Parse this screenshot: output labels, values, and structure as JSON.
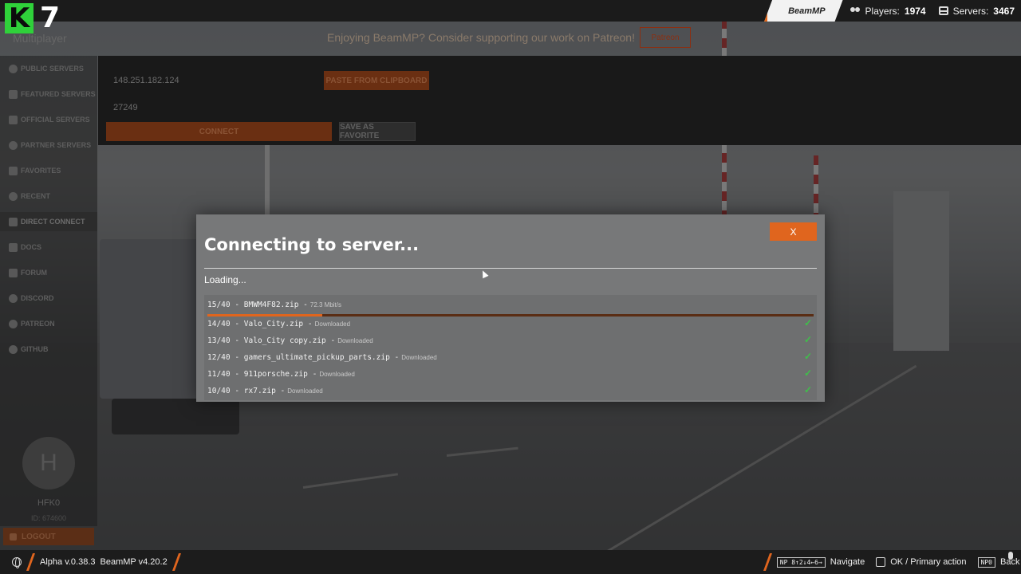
{
  "topbar": {
    "badge_letter": "K",
    "badge_number": "7",
    "brand": "BeamMP",
    "players_label": "Players:",
    "players_value": "1974",
    "servers_label": "Servers:",
    "servers_value": "3467"
  },
  "header": {
    "page_title": "Multiplayer",
    "patreon_banner": "Enjoying BeamMP? Consider supporting our work on Patreon!",
    "patreon_button": "Patreon"
  },
  "sidebar": {
    "items": [
      {
        "label": "Public Servers",
        "icon": "compass-icon"
      },
      {
        "label": "Featured Servers",
        "icon": "star-icon"
      },
      {
        "label": "Official Servers",
        "icon": "monitor-icon"
      },
      {
        "label": "Partner Servers",
        "icon": "globe-icon"
      },
      {
        "label": "Favorites",
        "icon": "bookmark-icon"
      },
      {
        "label": "Recent",
        "icon": "history-icon"
      },
      {
        "label": "Direct Connect",
        "icon": "link-icon"
      },
      {
        "label": "Docs",
        "icon": "document-icon"
      },
      {
        "label": "Forum",
        "icon": "chat-icon"
      },
      {
        "label": "Discord",
        "icon": "discord-icon"
      },
      {
        "label": "Patreon",
        "icon": "patreon-icon"
      },
      {
        "label": "GitHub",
        "icon": "github-icon"
      }
    ],
    "avatar_initial": "H",
    "username": "HFK0",
    "user_id": "ID: 674600",
    "logout": "Logout"
  },
  "direct_connect": {
    "ip_value": "148.251.182.124",
    "port_value": "27249",
    "paste_button": "Paste from clipboard",
    "connect_button": "Connect",
    "favorite_button": "Save as favorite"
  },
  "modal": {
    "title": "Connecting to server...",
    "close_label": "X",
    "status": "Loading...",
    "downloads": [
      {
        "index": "15/40",
        "file": "BMWM4F82.zip",
        "status": "72.3 Mbit/s",
        "done": false,
        "progress": 0.19
      },
      {
        "index": "14/40",
        "file": "Valo_City.zip",
        "status": "Downloaded",
        "done": true
      },
      {
        "index": "13/40",
        "file": "Valo_City copy.zip",
        "status": "Downloaded",
        "done": true
      },
      {
        "index": "12/40",
        "file": "gamers_ultimate_pickup_parts.zip",
        "status": "Downloaded",
        "done": true
      },
      {
        "index": "11/40",
        "file": "911porsche.zip",
        "status": "Downloaded",
        "done": true
      },
      {
        "index": "10/40",
        "file": "rx7.zip",
        "status": "Downloaded",
        "done": true
      }
    ]
  },
  "bottombar": {
    "version_game": "Alpha v.0.38.3",
    "version_mod": "BeamMP v4.20.2",
    "nav_key": "NP 8↑2↓4←6→",
    "nav_label": "Navigate",
    "ok_label": "OK / Primary action",
    "back_key": "NP0",
    "back_label": "Back"
  },
  "colors": {
    "accent": "#e0651e",
    "check": "#3fbf4a",
    "badge_green": "#2fd13a"
  }
}
